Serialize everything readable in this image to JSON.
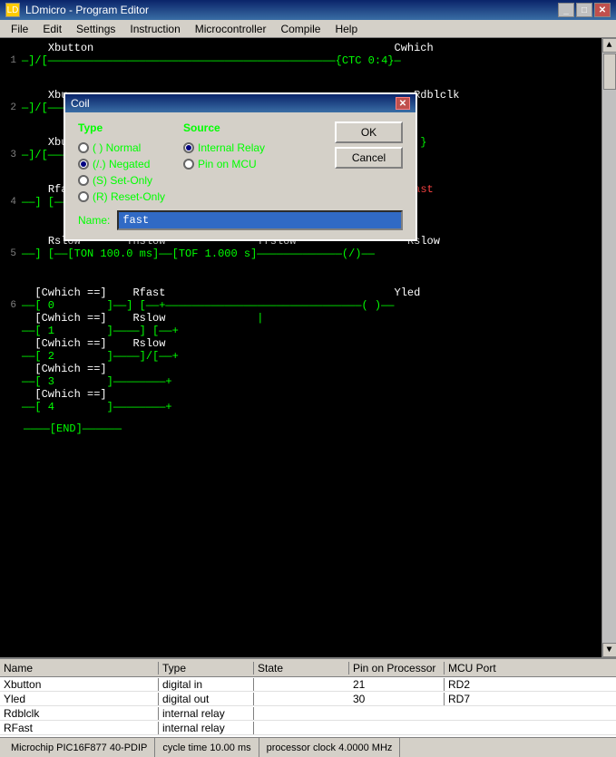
{
  "window": {
    "title": "LDmicro - Program Editor",
    "icon": "LD"
  },
  "menu": {
    "items": [
      "File",
      "Edit",
      "Settings",
      "Instruction",
      "Microcontroller",
      "Compile",
      "Help"
    ]
  },
  "dialog": {
    "title": "Coil",
    "type_label": "Type",
    "source_label": "Source",
    "types": [
      {
        "label": "( ) Normal",
        "selected": false,
        "id": "normal"
      },
      {
        "label": "(/.) Negated",
        "selected": true,
        "id": "negated"
      },
      {
        "label": "(S) Set-Only",
        "selected": false,
        "id": "set"
      },
      {
        "label": "(R) Reset-Only",
        "selected": false,
        "id": "reset"
      }
    ],
    "sources": [
      {
        "label": "Internal Relay",
        "selected": true
      },
      {
        "label": "Pin on MCU",
        "selected": false
      }
    ],
    "name_label": "Name:",
    "name_value": "fast",
    "ok_label": "OK",
    "cancel_label": "Cancel"
  },
  "ladder": {
    "rungs": [
      {
        "number": "1",
        "content": "    Xbutton                                              Cwhich\n—]/[————————————————————————————————————————————{CTC 0:4}—"
      },
      {
        "number": "2",
        "content": "    Xbu                                                  Rdblclk\n—]/[————————————————————————————————————————————( )———"
      },
      {
        "number": "3",
        "content": "    Xbu                                          {Cwhich := }\n—]/[——————————————————————————————————{ 3        MOV}—"
      },
      {
        "number": "4",
        "content": "    Rfast       Tffast           Tnfast                 Rfast\n——] [——[TOF 100.0 ms]——[TON 100.0 ms]————————————(/.)——"
      },
      {
        "number": "5",
        "content": "    Rslow       Tnslow           Tfslow                 Rslow\n——] [——[TON 100.0 ms]——[TOF 1.000 s]—————————————(/.)——"
      },
      {
        "number": "6",
        "content": "  [Cwhich ==]    Rfast                                   Yled\n——[ 0        ]——] [——+————————————————————————————( )——"
      }
    ]
  },
  "table": {
    "headers": [
      "Name",
      "Type",
      "State",
      "Pin on Processor",
      "MCU Port"
    ],
    "rows": [
      {
        "name": "Xbutton",
        "type": "digital in",
        "state": "",
        "pin": "21",
        "mcu": "RD2"
      },
      {
        "name": "Yled",
        "type": "digital out",
        "state": "",
        "pin": "30",
        "mcu": "RD7"
      },
      {
        "name": "Rdblclk",
        "type": "internal relay",
        "state": "",
        "pin": "",
        "mcu": ""
      },
      {
        "name": "RFast",
        "type": "internal relay",
        "state": "",
        "pin": "",
        "mcu": ""
      }
    ]
  },
  "status": {
    "processor": "Microchip PIC16F877 40-PDIP",
    "cycle_time": "cycle time 10.00 ms",
    "clock": "processor clock 4.0000 MHz"
  }
}
